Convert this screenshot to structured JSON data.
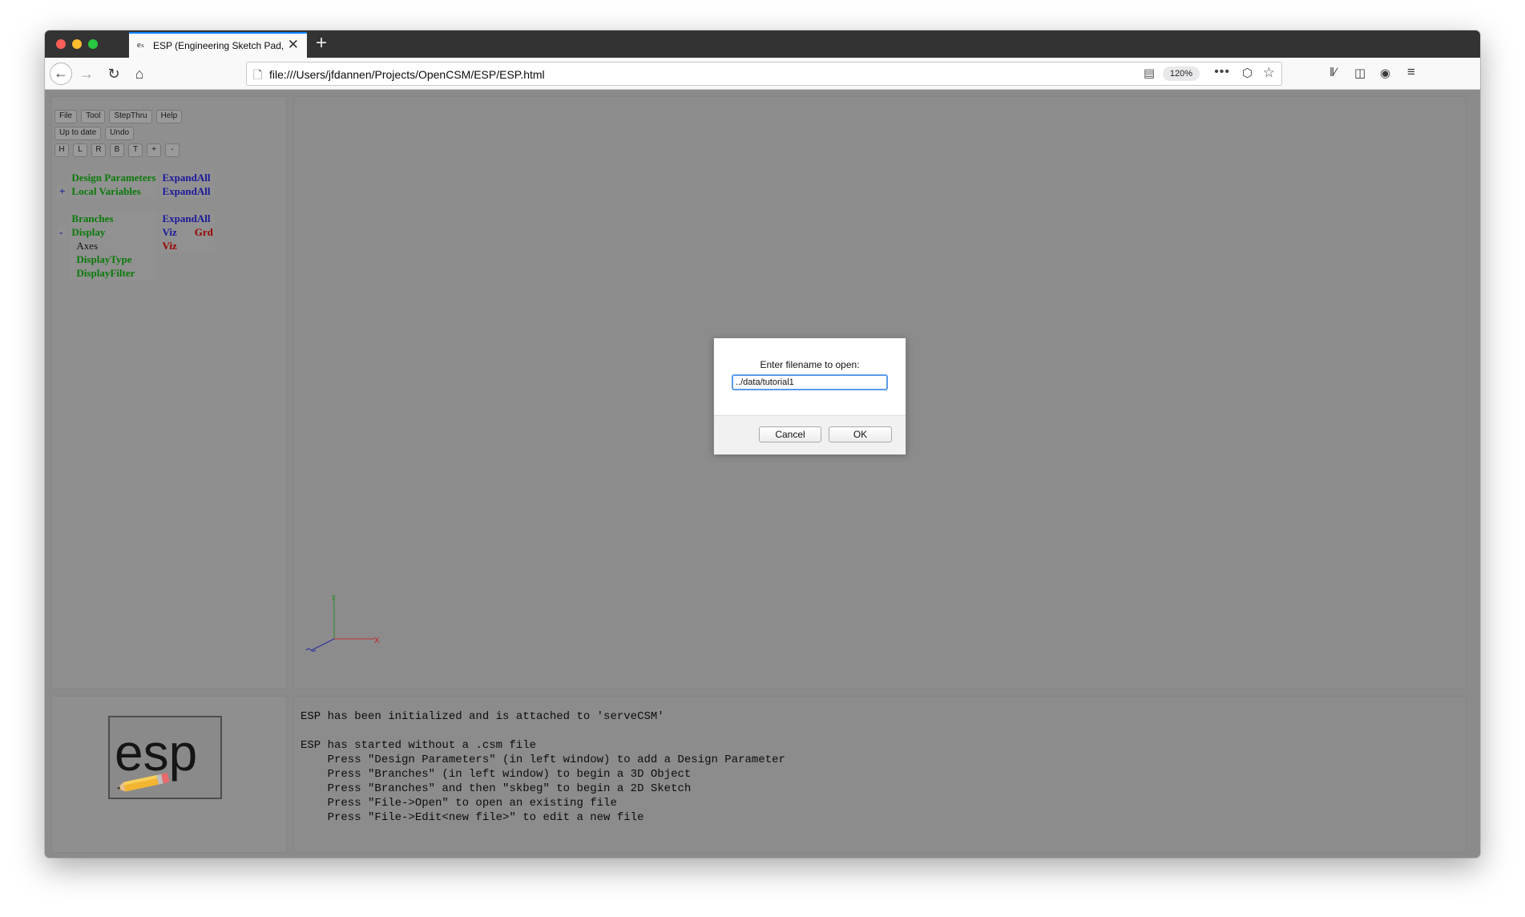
{
  "browser": {
    "tab_title": "ESP (Engineering Sketch Pad, V",
    "tab_favicon": "esp-favicon",
    "url": "file:///Users/jfdannen/Projects/OpenCSM/ESP/ESP.html",
    "zoom": "120%",
    "more_glyph": "•••"
  },
  "toolbar": {
    "row1": [
      "File",
      "Tool",
      "StepThru",
      "Help"
    ],
    "row2": [
      "Up to date",
      "Undo"
    ],
    "row3": [
      "H",
      "L",
      "R",
      "B",
      "T",
      "+",
      "-"
    ]
  },
  "tree": {
    "design_parameters": "Design Parameters",
    "expand_all": "ExpandAll",
    "local_vars_toggle": "+",
    "local_variables": "Local Variables",
    "branches": "Branches",
    "display_toggle": "-",
    "display": "Display",
    "viz": "Viz",
    "grd": "Grd",
    "axes": "Axes",
    "display_type": "DisplayType",
    "display_filter": "DisplayFilter"
  },
  "axes": {
    "x_label": "x",
    "y_label": "y",
    "x_color": "#c0302c",
    "y_color": "#2a8a2a",
    "z_color": "#2a2aa0"
  },
  "logo": {
    "text": "esp"
  },
  "messages": "ESP has been initialized and is attached to 'serveCSM'\n\nESP has started without a .csm file\n    Press \"Design Parameters\" (in left window) to add a Design Parameter\n    Press \"Branches\" (in left window) to begin a 3D Object\n    Press \"Branches\" and then \"skbeg\" to begin a 2D Sketch\n    Press \"File->Open\" to open an existing file\n    Press \"File->Edit<new file>\" to edit a new file",
  "dialog": {
    "prompt": "Enter filename to open:",
    "value": "../data/tutorial1",
    "cancel": "Cancel",
    "ok": "OK"
  }
}
